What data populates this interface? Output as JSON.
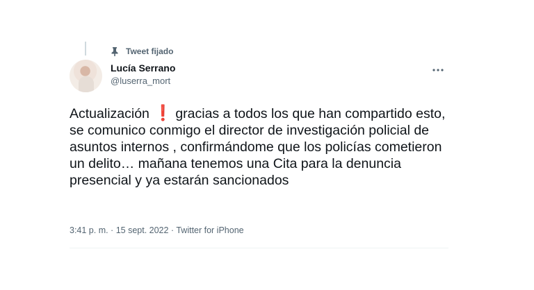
{
  "pinned": {
    "label": "Tweet fijado",
    "icon": "pin-icon"
  },
  "user": {
    "name": "Lucía Serrano",
    "handle": "@luserra_mort"
  },
  "menu": {
    "label": "•••",
    "icon": "more-icon"
  },
  "tweet": {
    "text_before": "Actualización",
    "emoji": "❗",
    "text_after": "gracias a todos los que han compartido esto, se comunico conmigo el director de investigación policial de asuntos internos , confirmándome que los policías cometieron un delito… mañana tenemos una Cita para la denuncia presencial y ya estarán sancionados"
  },
  "meta": {
    "time_date": "3:41 p. m. · 15 sept. 2022 · ",
    "source": "Twitter for iPhone"
  },
  "colors": {
    "text": "#0f1419",
    "muted": "#536471",
    "exclamation": "#d0021b",
    "divider": "#eff3f4"
  }
}
